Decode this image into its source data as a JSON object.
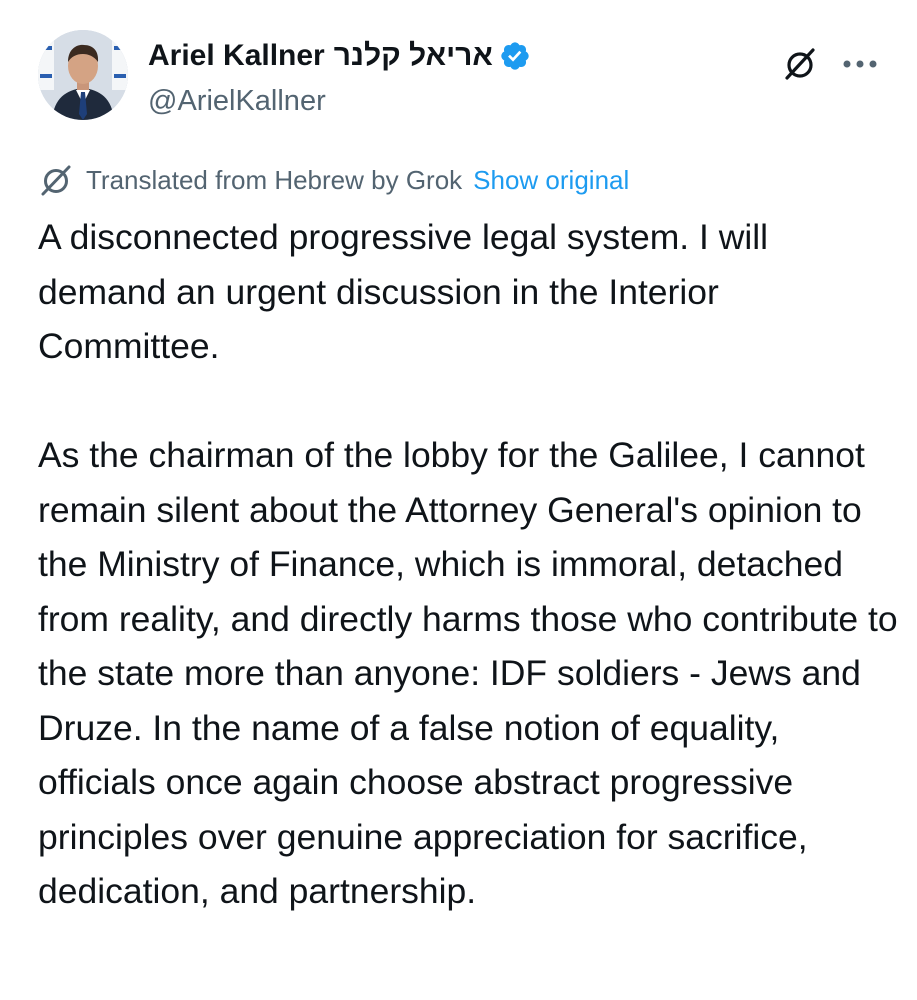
{
  "author": {
    "display_name": "Ariel Kallner",
    "display_name_hebrew": "אריאל קלנר",
    "handle": "@ArielKallner",
    "verified": true,
    "avatar_icon": "user-avatar-photo"
  },
  "actions": {
    "grok_icon": "grok-icon",
    "more_icon": "more-dots-icon"
  },
  "translation": {
    "note": "Translated from Hebrew by Grok",
    "show_original": "Show original",
    "icon": "grok-icon"
  },
  "tweet": {
    "paragraphs": [
      "A disconnected progressive legal system. I will demand an urgent discussion in the Interior Committee.",
      "As the chairman of the lobby for the Galilee, I cannot remain silent about the Attorney General's opinion to the Ministry of Finance, which is immoral, detached from reality, and directly harms those who contribute to the state more than anyone: IDF soldiers - Jews and Druze. In the name of a false notion of equality, officials once again choose abstract progressive principles over genuine appreciation for sacrifice, dedication, and partnership."
    ]
  },
  "colors": {
    "text": "#0f1419",
    "secondary": "#536471",
    "link": "#1d9bf0",
    "verified_badge": "#1d9bf0"
  }
}
